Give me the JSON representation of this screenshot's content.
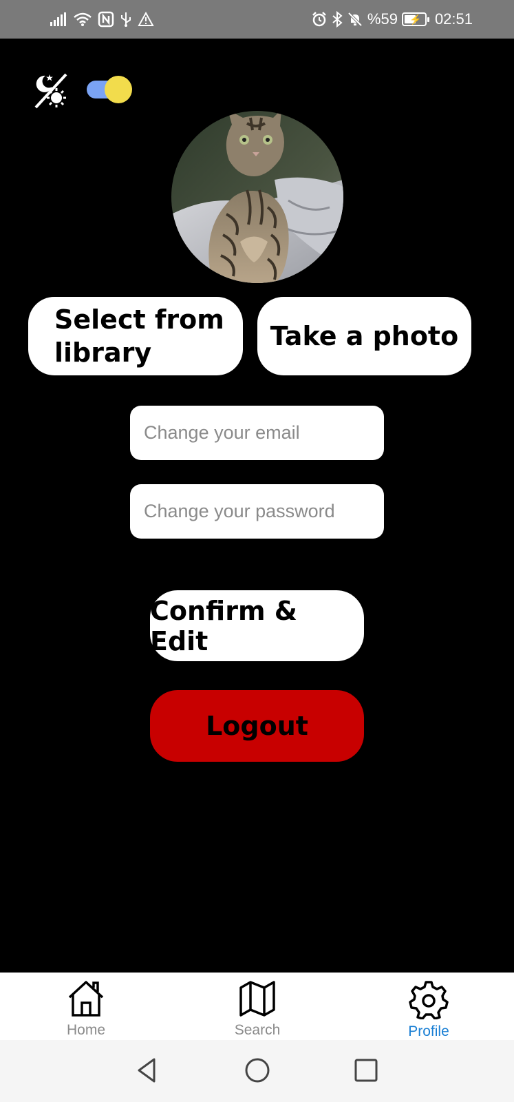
{
  "status_bar": {
    "battery": "%59",
    "battery_level": 0.59,
    "time": "02:51",
    "left_icons": [
      "signal-icon",
      "wifi-icon",
      "nfc-icon",
      "usb-icon",
      "warning-icon"
    ],
    "right_icons": [
      "alarm-icon",
      "bluetooth-icon",
      "mute-icon",
      "battery-charging-icon"
    ]
  },
  "theme": {
    "icon": "day-night-icon",
    "toggle_track_color": "#7aa3f4",
    "toggle_knob_color": "#f2dc4c"
  },
  "profile": {
    "avatar": "cat-photo",
    "select_from_library_label": "Select from library",
    "take_photo_label": "Take a photo",
    "email_placeholder": "Change your email",
    "password_placeholder": "Change your password",
    "confirm_label": "Confirm & Edit",
    "logout_label": "Logout",
    "logout_color": "#c80000"
  },
  "bottom_nav": {
    "items": [
      {
        "label": "Home",
        "icon": "home-icon",
        "active": false
      },
      {
        "label": "Search",
        "icon": "map-icon",
        "active": false
      },
      {
        "label": "Profile",
        "icon": "gear-icon",
        "active": true
      }
    ],
    "active_color": "#1a7fd4",
    "inactive_color": "#8a8a8a"
  },
  "system_nav": {
    "buttons": [
      "back-icon",
      "home-circle-icon",
      "recents-icon"
    ]
  }
}
